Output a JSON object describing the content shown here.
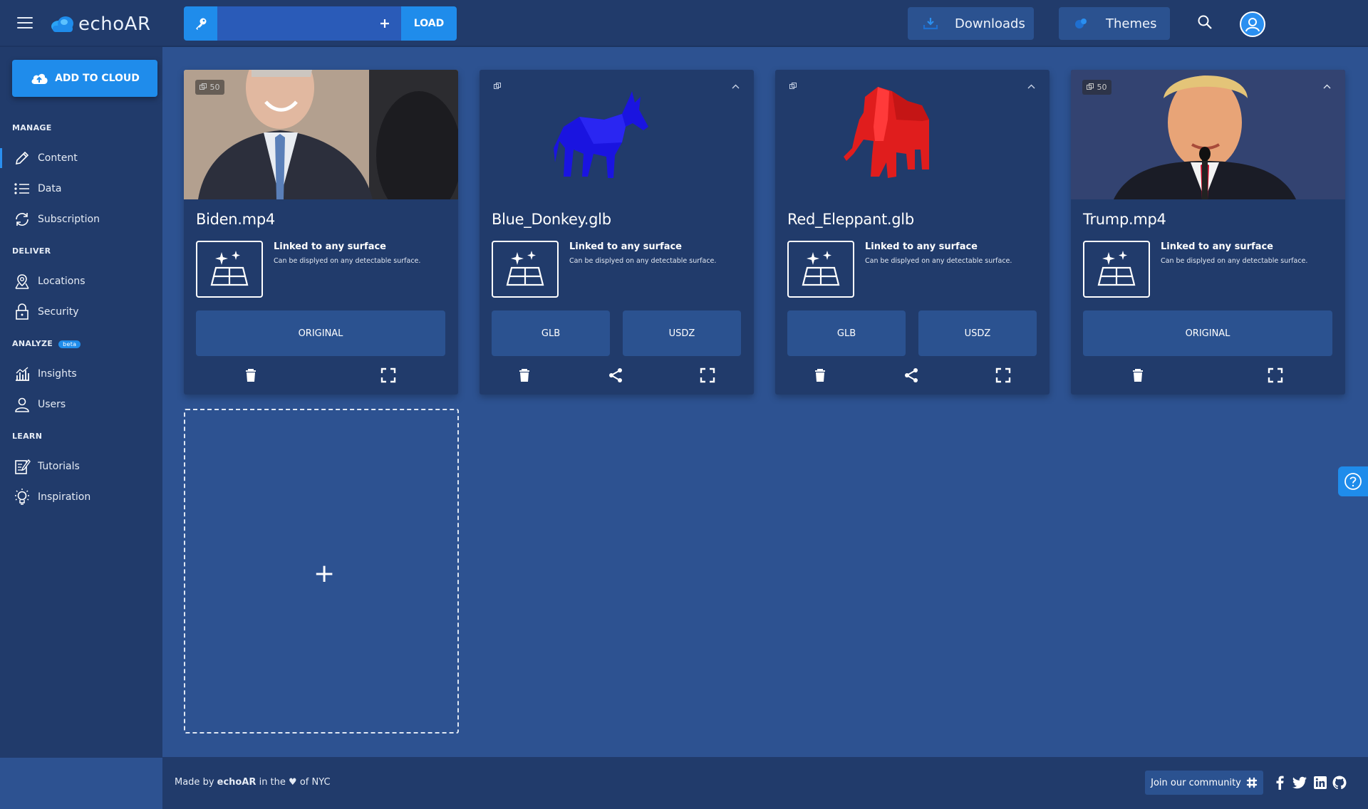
{
  "header": {
    "logo_text": "echoAR",
    "api_key_placeholder": "",
    "load_label": "LOAD",
    "downloads_label": "Downloads",
    "themes_label": "Themes"
  },
  "sidebar": {
    "add_to_cloud": "ADD TO CLOUD",
    "sections": {
      "manage": "MANAGE",
      "deliver": "DELIVER",
      "analyze": "ANALYZE",
      "analyze_badge": "beta",
      "learn": "LEARN"
    },
    "items": {
      "content": "Content",
      "data": "Data",
      "subscription": "Subscription",
      "locations": "Locations",
      "security": "Security",
      "insights": "Insights",
      "users": "Users",
      "tutorials": "Tutorials",
      "inspiration": "Inspiration"
    }
  },
  "cards": [
    {
      "title": "Biden.mp4",
      "badge": "50",
      "surface_title": "Linked to any surface",
      "surface_desc": "Can be displyed on any detectable surface.",
      "formats": [
        "ORIGINAL"
      ]
    },
    {
      "title": "Blue_Donkey.glb",
      "surface_title": "Linked to any surface",
      "surface_desc": "Can be displyed on any detectable surface.",
      "formats": [
        "GLB",
        "USDZ"
      ],
      "model_color": "#1a14e0"
    },
    {
      "title": "Red_Eleppant.glb",
      "surface_title": "Linked to any surface",
      "surface_desc": "Can be displyed on any detectable surface.",
      "formats": [
        "GLB",
        "USDZ"
      ],
      "model_color": "#e01d1d"
    },
    {
      "title": "Trump.mp4",
      "badge": "50",
      "surface_title": "Linked to any surface",
      "surface_desc": "Can be displyed on any detectable surface.",
      "formats": [
        "ORIGINAL"
      ]
    }
  ],
  "dropzone": {
    "plus": "+"
  },
  "footer": {
    "made_by": "Made by",
    "brand": "echoAR",
    "in_the": "in the",
    "heart": "♥",
    "of_nyc": "of NYC",
    "community": "Join our community"
  },
  "colors": {
    "topbar": "#213b6b",
    "background": "#2d5291",
    "accent": "#1f8ceb",
    "button": "#2b5290"
  }
}
